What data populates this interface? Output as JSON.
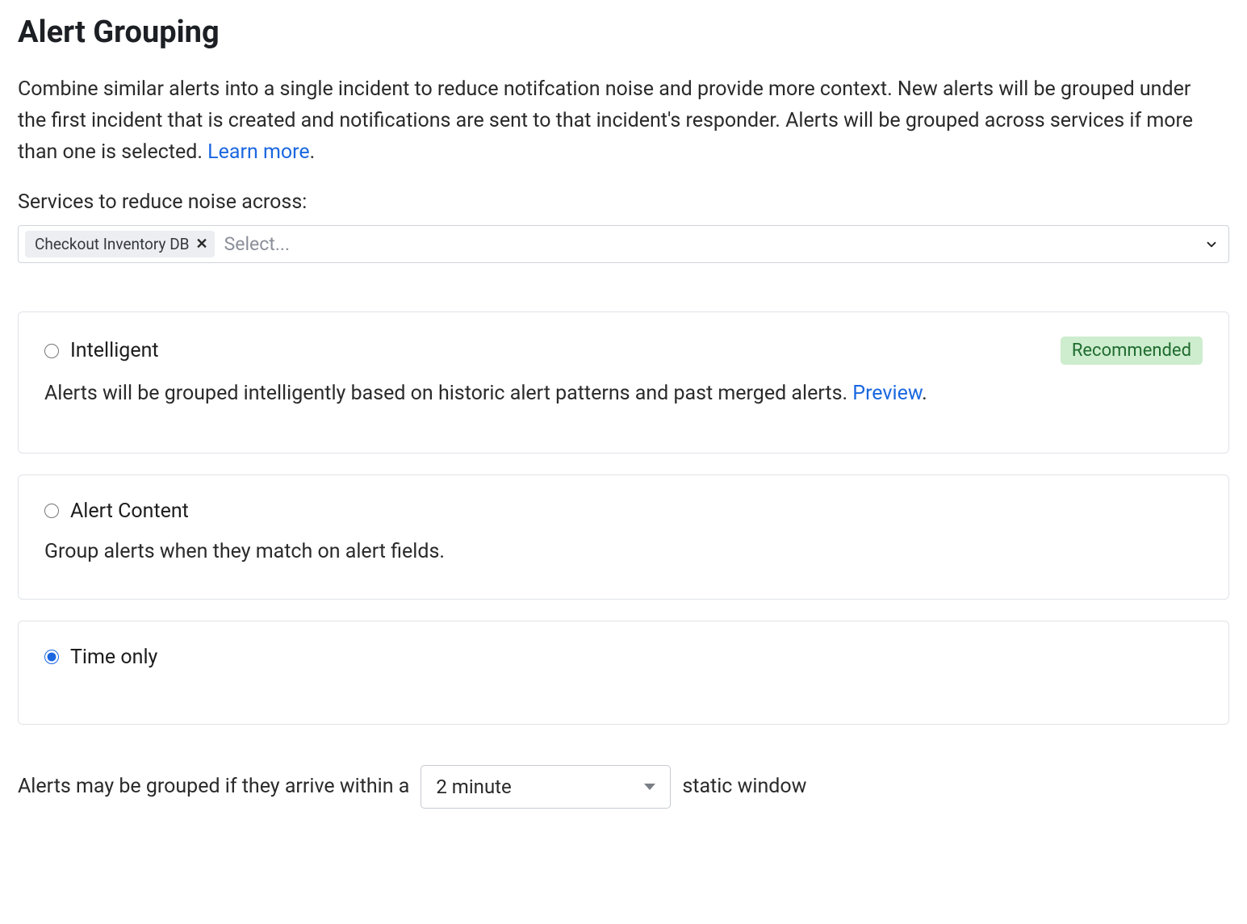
{
  "title": "Alert Grouping",
  "description": {
    "text_before_link": "Combine similar alerts into a single incident to reduce notifcation noise and provide more context. New alerts will be grouped under the first incident that is created and notifications are sent to that incident's responder. Alerts will be grouped across services if more than one is selected. ",
    "link_text": "Learn more",
    "text_after_link": "."
  },
  "services": {
    "label": "Services to reduce noise across:",
    "selected": [
      {
        "name": "Checkout Inventory DB"
      }
    ],
    "placeholder": "Select..."
  },
  "options": {
    "intelligent": {
      "title": "Intelligent",
      "badge": "Recommended",
      "desc_before_link": "Alerts will be grouped intelligently based on historic alert patterns and past merged alerts. ",
      "link_text": "Preview",
      "desc_after_link": "."
    },
    "alert_content": {
      "title": "Alert Content",
      "desc": "Group alerts when they match on alert fields."
    },
    "time_only": {
      "title": "Time only"
    }
  },
  "time_config": {
    "prefix": "Alerts may be grouped if they arrive within a",
    "value": "2 minute",
    "suffix": "static window"
  }
}
